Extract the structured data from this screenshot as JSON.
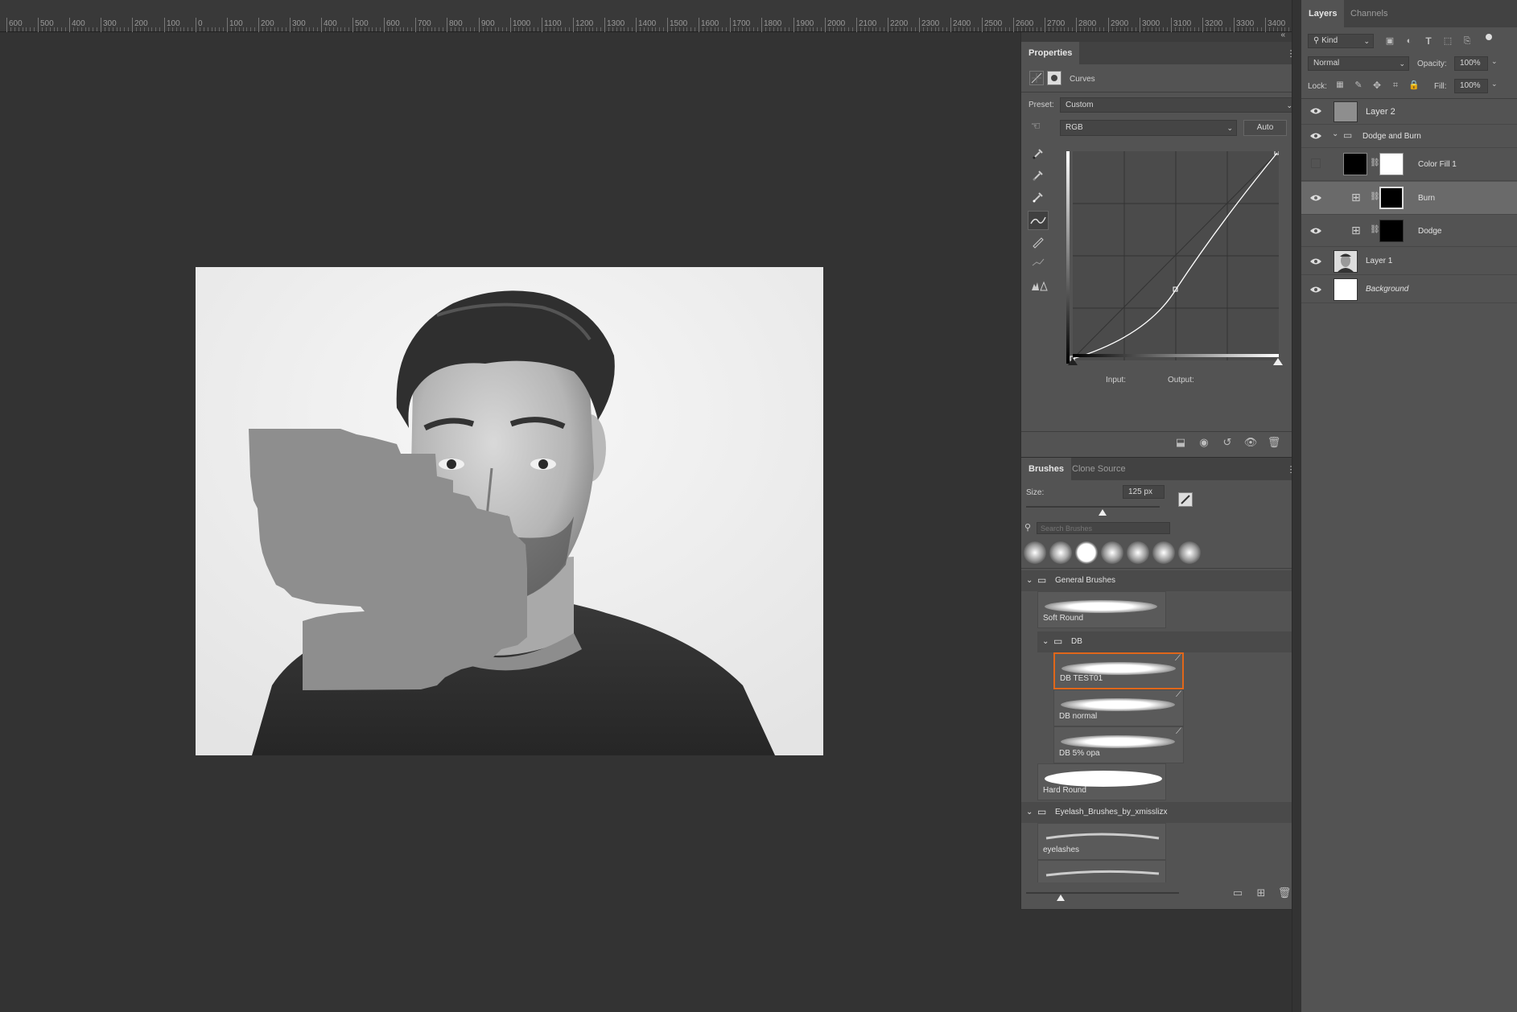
{
  "ruler": {
    "labels": [
      "600",
      "500",
      "400",
      "300",
      "200",
      "100",
      "0",
      "100",
      "200",
      "300",
      "400",
      "500",
      "600",
      "700",
      "800",
      "900",
      "1000",
      "1100",
      "1200",
      "1300",
      "1400",
      "1500",
      "1600",
      "1700",
      "1800",
      "1900",
      "2000",
      "2100",
      "2200",
      "2300",
      "2400",
      "2500",
      "2600",
      "2700",
      "2800",
      "2900",
      "3000",
      "3100",
      "3200",
      "3300",
      "3400"
    ]
  },
  "properties": {
    "tab_label": "Properties",
    "adjustment_type": "Curves",
    "preset_label": "Preset:",
    "preset_value": "Custom",
    "channel_value": "RGB",
    "auto_button": "Auto",
    "input_label": "Input:",
    "output_label": "Output:"
  },
  "brushes_panel": {
    "tabs": [
      "Brushes",
      "Clone Source"
    ],
    "size_label": "Size:",
    "size_value": "125 px",
    "size_fraction": 0.57,
    "search_placeholder": "Search Brushes",
    "groups": {
      "general": "General Brushes",
      "db": "DB",
      "eyelash": "Eyelash_Brushes_by_xmisslizx"
    },
    "brushes": {
      "soft_round": "Soft Round",
      "db_test01": "DB TEST01",
      "db_normal": "DB normal",
      "db_5opa": "DB 5% opa",
      "hard_round": "Hard Round",
      "eyelashes": "eyelashes"
    }
  },
  "layers_panel": {
    "tabs": [
      "Layers",
      "Channels"
    ],
    "filter_kind": "Kind",
    "blend_mode": "Normal",
    "opacity_label": "Opacity:",
    "opacity_value": "100%",
    "lock_label": "Lock:",
    "fill_label": "Fill:",
    "fill_value": "100%",
    "layers": [
      {
        "name": "Layer 2"
      },
      {
        "name": "Dodge and Burn"
      },
      {
        "name": "Color Fill 1"
      },
      {
        "name": "Burn"
      },
      {
        "name": "Dodge"
      },
      {
        "name": "Layer 1"
      },
      {
        "name": "Background"
      }
    ]
  },
  "colors": {
    "app_bg": "#333333",
    "panel_bg": "#535353",
    "selected_brush_border": "#e0671a",
    "selected_layer": "#6a6a6a"
  }
}
